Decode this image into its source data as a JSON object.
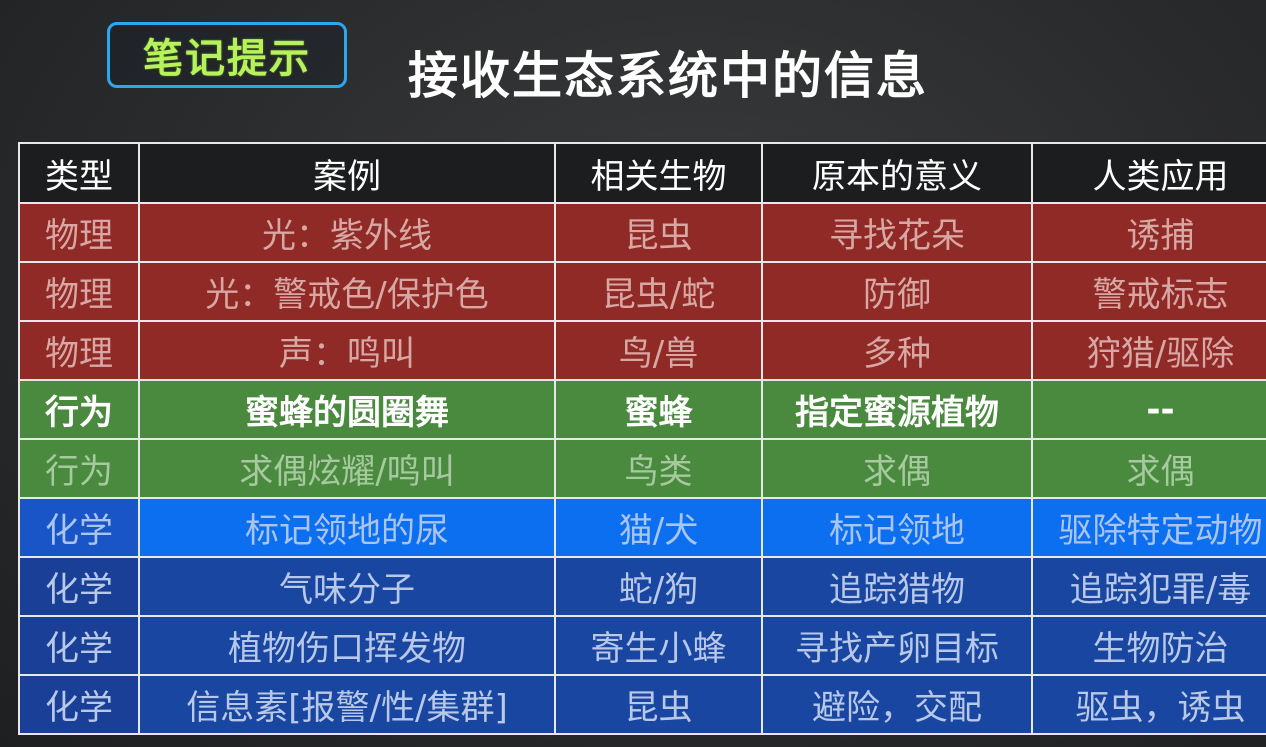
{
  "badge": {
    "label": "笔记提示"
  },
  "title": "接收生态系统中的信息",
  "table": {
    "headers": [
      "类型",
      "案例",
      "相关生物",
      "原本的意义",
      "人类应用"
    ],
    "rows": [
      {
        "style": "physical",
        "cells": [
          "物理",
          "光：紫外线",
          "昆虫",
          "寻找花朵",
          "诱捕"
        ]
      },
      {
        "style": "physical",
        "cells": [
          "物理",
          "光：警戒色/保护色",
          "昆虫/蛇",
          "防御",
          "警戒标志"
        ]
      },
      {
        "style": "physical",
        "cells": [
          "物理",
          "声：鸣叫",
          "鸟/兽",
          "多种",
          "狩猎/驱除"
        ]
      },
      {
        "style": "behavior-hl",
        "cells": [
          "行为",
          "蜜蜂的圆圈舞",
          "蜜蜂",
          "指定蜜源植物",
          "--"
        ]
      },
      {
        "style": "behavior",
        "cells": [
          "行为",
          "求偶炫耀/鸣叫",
          "鸟类",
          "求偶",
          "求偶"
        ]
      },
      {
        "style": "chem-bright",
        "cells": [
          "化学",
          "标记领地的尿",
          "猫/犬",
          "标记领地",
          "驱除特定动物"
        ]
      },
      {
        "style": "chem",
        "cells": [
          "化学",
          "气味分子",
          "蛇/狗",
          "追踪猎物",
          "追踪犯罪/毒"
        ]
      },
      {
        "style": "chem",
        "cells": [
          "化学",
          "植物伤口挥发物",
          "寄生小蜂",
          "寻找产卵目标",
          "生物防治"
        ]
      },
      {
        "style": "chem",
        "cells": [
          "化学",
          "信息素[报警/性/集群]",
          "昆虫",
          "避险，交配",
          "驱虫，诱虫"
        ]
      }
    ]
  }
}
